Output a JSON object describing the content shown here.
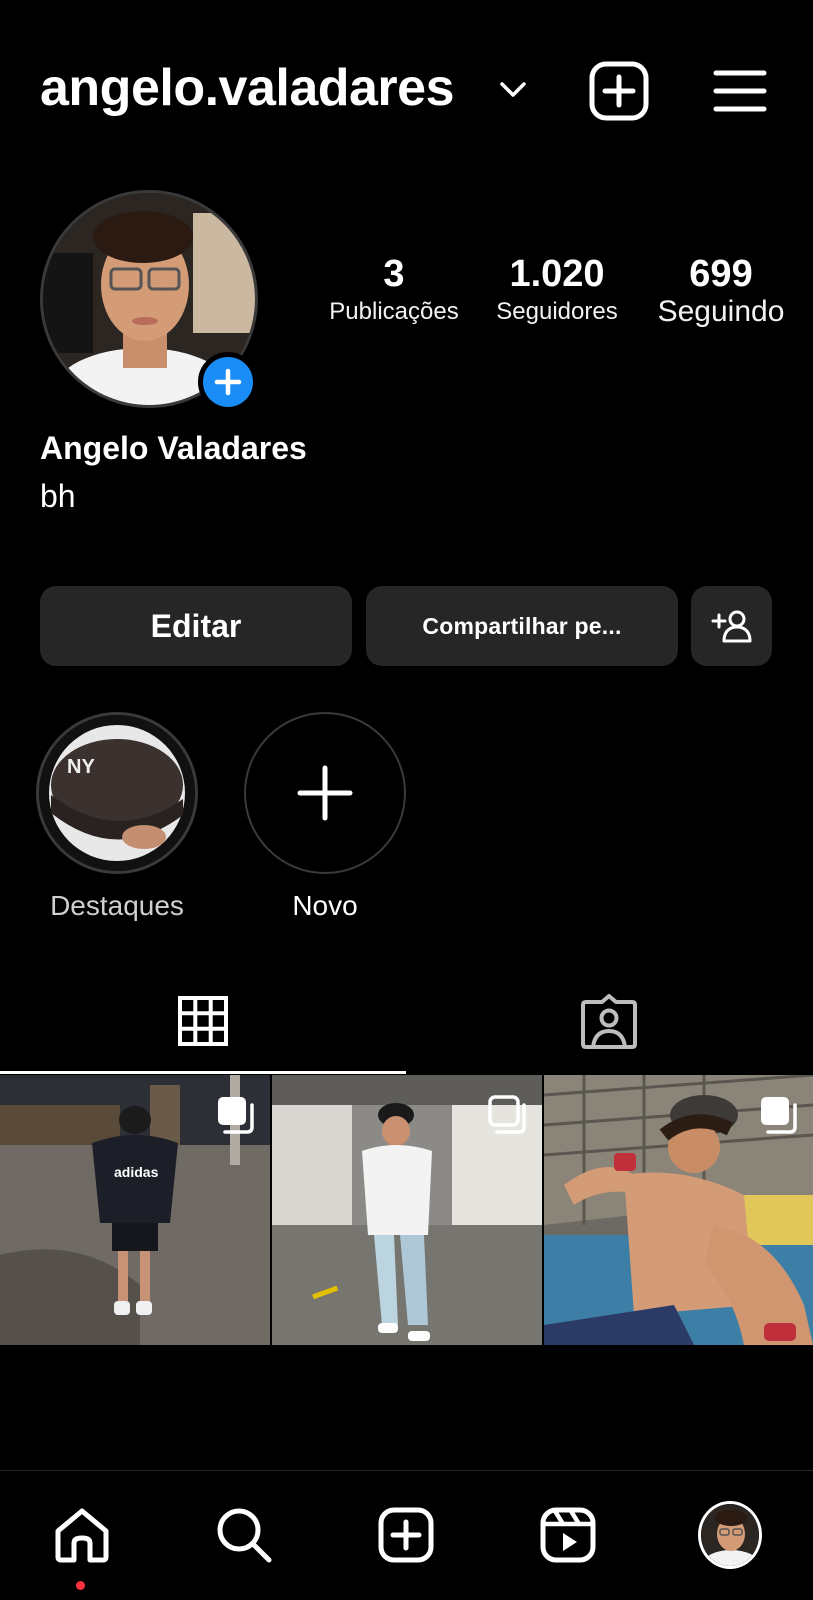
{
  "header": {
    "username": "angelo.valadares"
  },
  "profile": {
    "full_name": "Angelo Valadares",
    "bio": "bh",
    "stats": [
      {
        "value": "3",
        "label": "Publicações"
      },
      {
        "value": "1.020",
        "label": "Seguidores"
      },
      {
        "value": "699",
        "label": "Seguindo"
      }
    ]
  },
  "actions": {
    "edit_label": "Editar",
    "share_label": "Compartilhar pe..."
  },
  "highlights": [
    {
      "label": "Destaques"
    },
    {
      "label": "Novo"
    }
  ],
  "tabs": {
    "active": "grid"
  },
  "colors": {
    "background": "#000000",
    "button_bg": "#262626",
    "accent_blue": "#1a8cf5",
    "notification_dot": "#ff3040"
  },
  "icons": [
    "chevron-down-icon",
    "new-post-icon",
    "menu-icon",
    "add-person-icon",
    "plus-icon",
    "grid-icon",
    "tagged-icon",
    "carousel-icon",
    "home-icon",
    "search-icon",
    "create-icon",
    "reels-icon"
  ]
}
